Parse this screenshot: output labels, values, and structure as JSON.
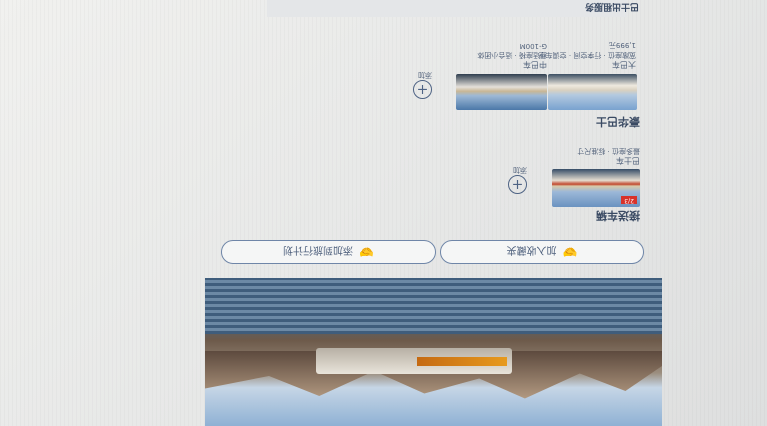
{
  "hero": {
    "image": "bus-by-lake-with-mountains"
  },
  "actions": {
    "left": {
      "label": "加入收藏夹",
      "icon": "handshake-icon"
    },
    "right": {
      "label": "添加到旅行计划",
      "icon": "handshake-icon"
    }
  },
  "section_one": {
    "title": "接送车辆",
    "item": {
      "badge": "2/3",
      "name": "巴士车",
      "meta": "最多座位 · 标准尺寸",
      "price_label": "添加",
      "add_icon": "plus-circle-icon"
    }
  },
  "section_two": {
    "title": "豪华巴士",
    "items": [
      {
        "name": "大巴车",
        "meta": "宽敞座位 · 行李空间 · 空调车型",
        "price": "1,999元",
        "add_label": "添加",
        "add_icon": "plus-circle-icon"
      },
      {
        "name": "中巴车",
        "meta": "舒适座椅 · 适合小团体",
        "price": "G-100M"
      }
    ]
  },
  "top_strip": {
    "label": "巴士出租服务"
  },
  "colors": {
    "accent": "#3d4f6c",
    "outline": "#6f86a8",
    "badge": "#d8322a"
  }
}
